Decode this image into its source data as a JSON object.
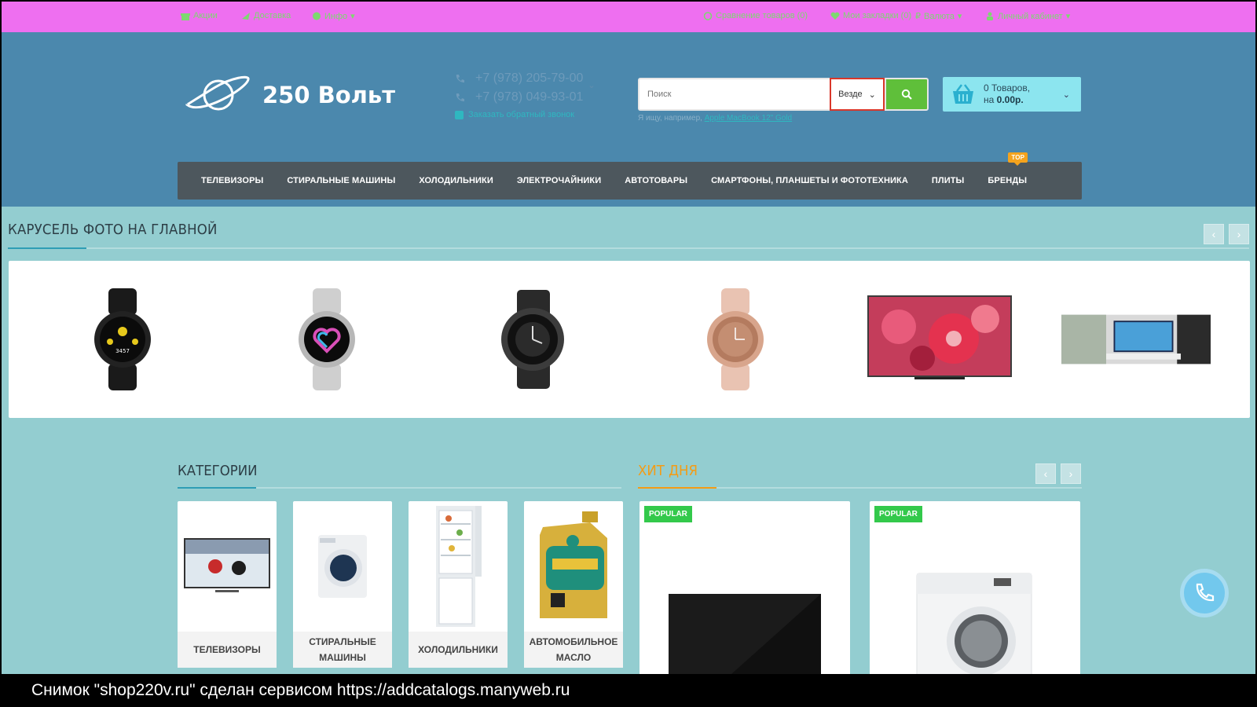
{
  "topbar": {
    "links_left": [
      "Акции",
      "Доставка",
      "Инфо"
    ],
    "links_right": [
      "Сравнение товаров (0)",
      "Мои закладки (0)",
      "Валюта",
      "Личный кабинет"
    ]
  },
  "header": {
    "logo_text": "250 Вольт",
    "phones": [
      "+7 (978) 205-79-00",
      "+7 (978) 049-93-01"
    ],
    "callback_text": "Заказать обратный звонок",
    "search": {
      "placeholder": "Поиск",
      "scope": "Везде",
      "hint_prefix": "Я ищу, например,",
      "hint_link": "Apple MacBook 12\" Gold"
    },
    "cart": {
      "line1": "0 Товаров,",
      "line2_prefix": "на",
      "line2_amount": "0.00р."
    }
  },
  "nav": {
    "items": [
      "ТЕЛЕВИЗОРЫ",
      "СТИРАЛЬНЫЕ МАШИНЫ",
      "ХОЛОДИЛЬНИКИ",
      "ЭЛЕКТРОЧАЙНИКИ",
      "АВТОТОВАРЫ",
      "СМАРТФОНЫ, ПЛАНШЕТЫ И ФОТОТЕХНИКА",
      "ПЛИТЫ",
      "БРЕНДЫ"
    ],
    "badge": "TOP"
  },
  "carousel": {
    "title": "КАРУСЕЛЬ ФОТО НА ГЛАВНОЙ"
  },
  "categories": {
    "title": "КАТЕГОРИИ",
    "items": [
      {
        "label": "ТЕЛЕВИЗОРЫ"
      },
      {
        "label": "СТИРАЛЬНЫЕ МАШИНЫ"
      },
      {
        "label": "ХОЛОДИЛЬНИКИ"
      },
      {
        "label": "АВТОМОБИЛЬНОЕ МАСЛО"
      }
    ]
  },
  "hit": {
    "title": "ХИТ ДНЯ",
    "badges": [
      "POPULAR",
      "POPULAR"
    ]
  },
  "footer_text": "Снимок \"shop220v.ru\" сделан сервисом https://addcatalogs.manyweb.ru",
  "colors": {
    "topbar": "#ee6ff0",
    "header": "#4b88ad",
    "page": "#93cdd0",
    "accent_green": "#5fbf3a",
    "accent_orange": "#f39c16"
  }
}
